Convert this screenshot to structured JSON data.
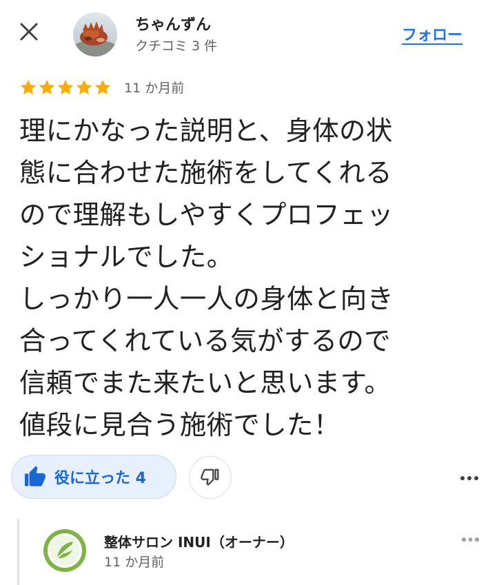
{
  "header": {
    "close_icon": "close-icon",
    "user_name": "ちゃんずん",
    "user_meta": "クチコミ 3 件",
    "follow_label": "フォロー"
  },
  "review": {
    "rating": 5,
    "rating_max": 5,
    "time": "11 か月前",
    "lines": [
      "理にかなった説明と、身体の状",
      "態に合わせた施術をしてくれる",
      "ので理解もしやすくプロフェッ",
      "ショナルでした。",
      "しっかり一人一人の身体と向き",
      "合ってくれている気がするので",
      "信頼でまた来たいと思います。",
      "値段に見合う施術でした！"
    ]
  },
  "actions": {
    "helpful_label": "役に立った 4",
    "helpful_icon": "thumbs-up-icon",
    "dislike_icon": "thumbs-down-icon",
    "more_icon": "more-horizontal-icon"
  },
  "owner_reply": {
    "name": "整体サロン INUI（オーナー）",
    "time": "11 か月前",
    "more_icon": "more-horizontal-icon"
  },
  "colors": {
    "accent": "#1a73e8",
    "star": "#f9ab00",
    "helpful_bg": "#e8f0fe",
    "owner_logo": "#7fb343"
  }
}
